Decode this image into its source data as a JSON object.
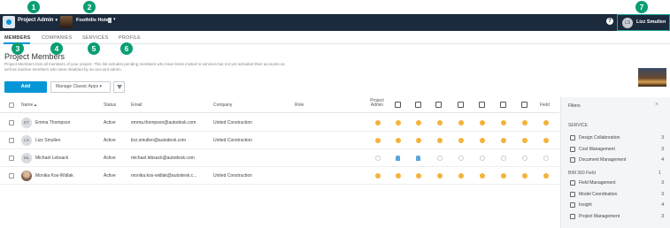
{
  "header": {
    "account_label": "Project Admin",
    "project_name": "Foothills Hotel",
    "help_icon": "?",
    "user_initials": "LS",
    "user_name": "Lizz Smullen"
  },
  "tabs": [
    {
      "label": "MEMBERS",
      "active": true
    },
    {
      "label": "COMPANIES"
    },
    {
      "label": "SERVICES"
    },
    {
      "label": "PROFILE"
    }
  ],
  "markers": [
    "1",
    "2",
    "3",
    "4",
    "5",
    "6",
    "7"
  ],
  "page": {
    "title": "Project Members",
    "description": "Project Members lists all members of your project. This list includes pending members who have been invited to services but not yet activated their accounts as well as inactive members who were disabled by an account admin.",
    "add_label": "Add",
    "classic_label": "Manage Classic Apps ▾"
  },
  "table": {
    "headers": {
      "name": "Name ▴",
      "status": "Status",
      "email": "Email",
      "company": "Company",
      "role": "Role",
      "project_admin": "Project Admin",
      "field": "Field"
    },
    "rows": [
      {
        "initials": "ET",
        "name": "Emma Thompson",
        "status": "Active",
        "email": "emma.thompson@autodesk.com",
        "company": "United Construction",
        "perms": [
          "orange",
          "orange",
          "orange",
          "orange",
          "orange",
          "orange",
          "orange",
          "orange",
          "orange",
          "grey"
        ]
      },
      {
        "initials": "LS",
        "name": "Lizz Smullen",
        "status": "Active",
        "email": "lizz.smullen@autodesk.com",
        "company": "United Construction",
        "perms": [
          "orange",
          "orange",
          "orange",
          "orange",
          "orange",
          "orange",
          "orange",
          "orange",
          "orange",
          "grey"
        ]
      },
      {
        "initials": "ML",
        "name": "Michael Lebsack",
        "status": "Active",
        "email": "michael.lebsack@autodesk.com",
        "company": "",
        "perms": [
          "grey",
          "blue",
          "blue",
          "grey",
          "grey",
          "grey",
          "grey",
          "grey",
          "grey",
          "grey"
        ]
      },
      {
        "initials": "",
        "name": "Monika Kos-Widlak",
        "status": "Active",
        "email": "monika.kos-widlak@autodesk.c...",
        "company": "United Construction",
        "perms": [
          "orange",
          "orange",
          "orange",
          "orange",
          "orange",
          "orange",
          "orange",
          "orange",
          "orange",
          "grey"
        ]
      }
    ]
  },
  "filters": {
    "title": "Filters",
    "close_icon": "×",
    "service_heading": "SERVICE",
    "service_items": [
      {
        "label": "Design Collaboration",
        "count": "3"
      },
      {
        "label": "Cost Management",
        "count": "3"
      },
      {
        "label": "Document Management",
        "count": "4"
      }
    ],
    "bim_heading": "BIM 360 Field",
    "bim_items": [
      {
        "label": "Field Management",
        "count": "3"
      },
      {
        "label": "Model Coordination",
        "count": "3"
      },
      {
        "label": "Insight",
        "count": "4"
      },
      {
        "label": "Project Management",
        "count": "3"
      }
    ],
    "bim_heading_count": "1"
  },
  "colors": {
    "topbar": "#1b2a3c",
    "accent": "#0696d7",
    "marker": "#0b9e74",
    "perm_on": "#f4b23a"
  }
}
